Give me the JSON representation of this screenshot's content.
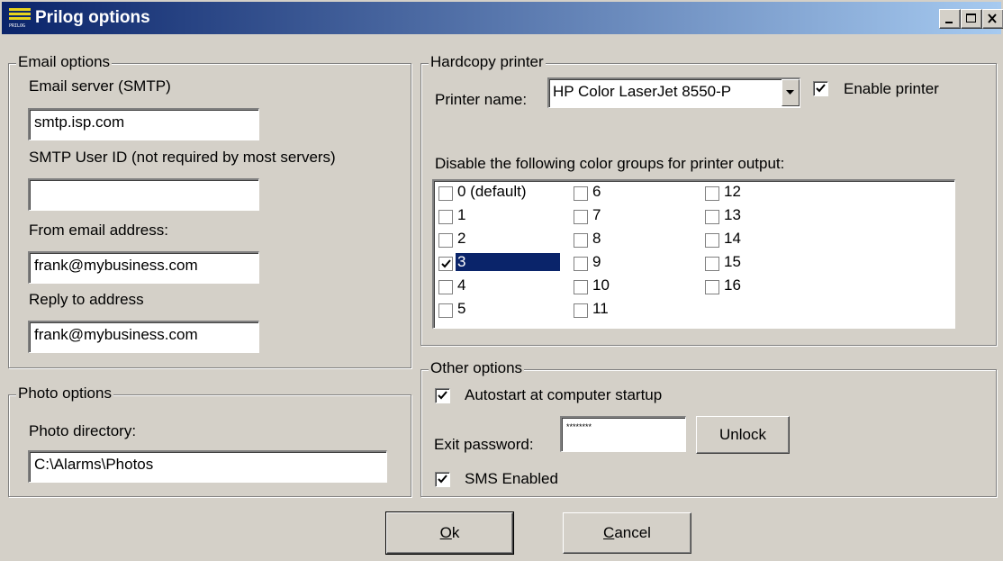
{
  "window": {
    "title": "Prilog options",
    "icon": "prilog-app-icon",
    "icon_label": "PRILOG",
    "controls": [
      "minimize-icon",
      "maximize-icon",
      "close-icon"
    ]
  },
  "email": {
    "legend": "Email options",
    "server_label": "Email server (SMTP)",
    "server_value": "smtp.isp.com",
    "user_label": "SMTP User ID (not required by most servers)",
    "user_value": "",
    "from_label": "From email address:",
    "from_value": "frank@mybusiness.com",
    "reply_label": "Reply to address",
    "reply_value": "frank@mybusiness.com"
  },
  "photo": {
    "legend": "Photo options",
    "dir_label": "Photo directory:",
    "dir_value": "C:\\Alarms\\Photos"
  },
  "printer": {
    "legend": "Hardcopy printer",
    "name_label": "Printer name:",
    "name_value": "HP Color LaserJet 8550-P",
    "enable_label": "Enable printer",
    "enable_checked": true,
    "disable_label": "Disable the following color groups for printer output:",
    "groups": [
      {
        "label": "0 (default)",
        "checked": false
      },
      {
        "label": "1",
        "checked": false
      },
      {
        "label": "2",
        "checked": false
      },
      {
        "label": "3",
        "checked": true,
        "selected": true
      },
      {
        "label": "4",
        "checked": false
      },
      {
        "label": "5",
        "checked": false
      },
      {
        "label": "6",
        "checked": false
      },
      {
        "label": "7",
        "checked": false
      },
      {
        "label": "8",
        "checked": false
      },
      {
        "label": "9",
        "checked": false
      },
      {
        "label": "10",
        "checked": false
      },
      {
        "label": "11",
        "checked": false
      },
      {
        "label": "12",
        "checked": false
      },
      {
        "label": "13",
        "checked": false
      },
      {
        "label": "14",
        "checked": false
      },
      {
        "label": "15",
        "checked": false
      },
      {
        "label": "16",
        "checked": false
      }
    ]
  },
  "other": {
    "legend": "Other options",
    "autostart_label": "Autostart at computer startup",
    "autostart_checked": true,
    "password_label": "Exit password:",
    "password_value": "********",
    "unlock_label": "Unlock",
    "sms_label": "SMS Enabled",
    "sms_checked": true
  },
  "footer": {
    "ok_label": "Ok",
    "cancel_label": "Cancel"
  },
  "colors": {
    "title_gradient_start": "#0a246a",
    "title_gradient_end": "#a6caf0",
    "selection": "#0a246a",
    "face": "#d4d0c8"
  }
}
